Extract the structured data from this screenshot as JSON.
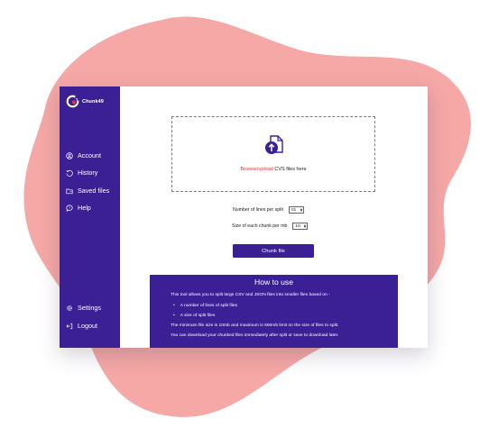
{
  "app": {
    "brand_name": "Chunk49"
  },
  "sidebar": {
    "items": [
      {
        "label": "Account",
        "icon": "user-circle-icon"
      },
      {
        "label": "History",
        "icon": "history-icon"
      },
      {
        "label": "Saved files",
        "icon": "folder-icon"
      },
      {
        "label": "Help",
        "icon": "help-bubble-icon"
      }
    ],
    "bottom_items": [
      {
        "label": "Settings",
        "icon": "gear-icon"
      },
      {
        "label": "Logout",
        "icon": "logout-icon"
      }
    ]
  },
  "upload": {
    "link_text": "Browse/upload",
    "suffix_text": " CVS files here",
    "icon": "file-upload-icon"
  },
  "form": {
    "lines_label": "Number of lines per split",
    "lines_value": "01",
    "chunk_label": "Size of each chunk per mb",
    "chunk_value": "10",
    "submit_label": "Chunk file"
  },
  "howto": {
    "title": "How to use",
    "intro": "This tool allows you to split large CSV and JSON files into smaller files based on -",
    "bullets": [
      "A number of lines of split files",
      "A size of split files"
    ],
    "limits": "The minimum file size is 10mb and maximum is 500mb limit on the size of files to split.",
    "download": "You can download your chunked files immediately after split or save to download later."
  },
  "colors": {
    "accent": "#3a1f95",
    "link": "#e0383e",
    "blob": "#f5a8a6"
  }
}
